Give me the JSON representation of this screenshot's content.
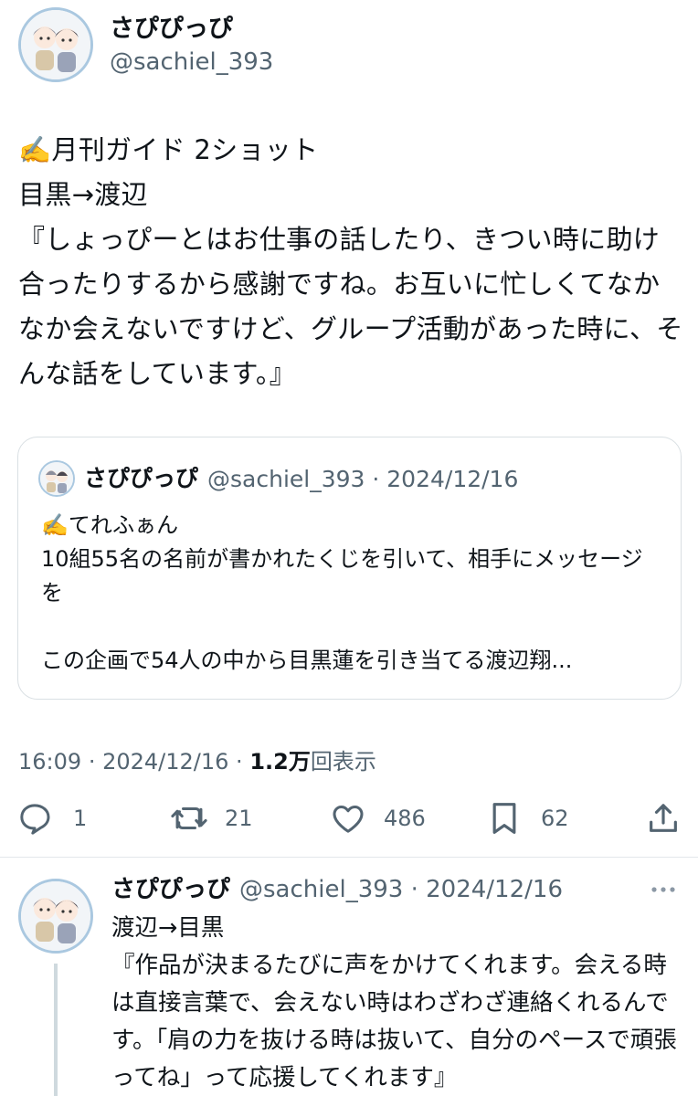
{
  "main_tweet": {
    "display_name": "さぴぴっぴ",
    "handle": "@sachiel_393",
    "text": "✍️月刊ガイド 2ショット\n目黒→渡辺\n『しょっぴーとはお仕事の話したり、きつい時に助け合ったりするから感謝ですね。お互いに忙しくてなかなか会えないですけど、グループ活動があった時に、そんな話をしています。』",
    "time": "16:09",
    "date": "2024/12/16",
    "views_count": "1.2万",
    "views_label": "回表示"
  },
  "quote": {
    "display_name": "さぴぴっぴ",
    "meta": "@sachiel_393 · 2024/12/16",
    "text": "✍️てれふぁん\n10組55名の名前が書かれたくじを引いて、相手にメッセージを\n\nこの企画で54人の中から目黒蓮を引き当てる渡辺翔..."
  },
  "actions": {
    "replies": "1",
    "retweets": "21",
    "likes": "486",
    "bookmarks": "62"
  },
  "reply": {
    "display_name": "さぴぴっぴ",
    "meta": "@sachiel_393 · 2024/12/16",
    "text": "渡辺→目黒\n『作品が決まるたびに声をかけてくれます。会える時は直接言葉で、会えない時はわざわざ連絡くれるんです。「肩の力を抜ける時は抜いて、自分のペースで頑張ってね」って応援してくれます』"
  },
  "icons": {
    "reply": "reply-icon",
    "retweet": "retweet-icon",
    "like": "heart-icon",
    "bookmark": "bookmark-icon",
    "share": "share-icon",
    "more": "more-icon"
  },
  "colors": {
    "text": "#0f1419",
    "secondary": "#536471",
    "border": "#d9dfe3",
    "avatar_ring": "#aac8e0"
  }
}
